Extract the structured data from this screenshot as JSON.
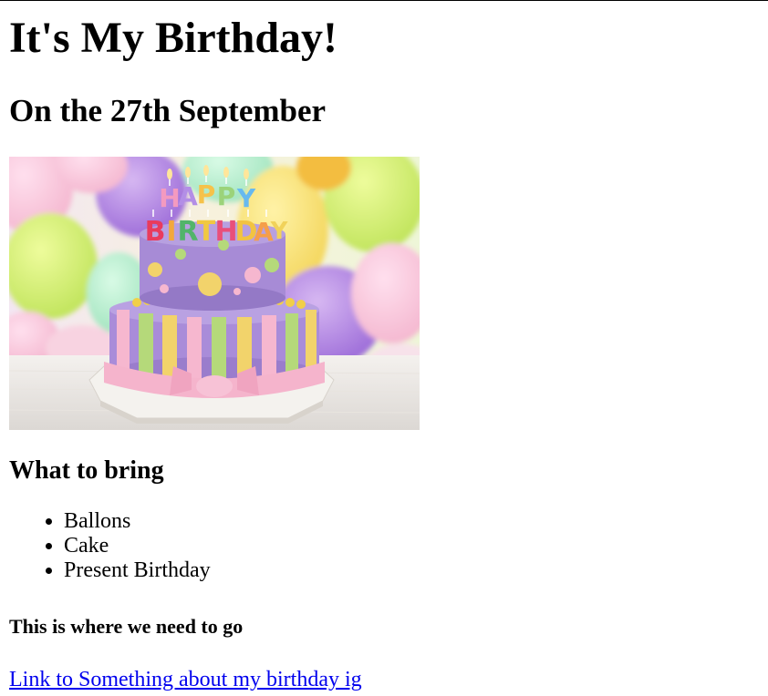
{
  "heading": {
    "title": "It's My Birthday!",
    "date": "On the 27th September"
  },
  "image": {
    "subject": "Two-tier birthday cake with HAPPY BIRTHDAY candles in front of colorful balloons",
    "candle_letters": [
      "H",
      "A",
      "P",
      "P",
      "Y",
      "B",
      "I",
      "R",
      "T",
      "H",
      "D",
      "A",
      "Y"
    ]
  },
  "bring_section": {
    "heading": "What to bring",
    "items": [
      "Ballons",
      "Cake",
      "Present Birthday"
    ]
  },
  "location": {
    "heading": "This is where we need to go"
  },
  "link": {
    "text": "Link to Something about my birthday ig"
  },
  "colors": {
    "link": "#0000ee",
    "cake_purple": "#a78bd6",
    "cake_pink": "#f6b7cf",
    "cake_yellow": "#f2d36b",
    "cake_green": "#b5d97a"
  }
}
